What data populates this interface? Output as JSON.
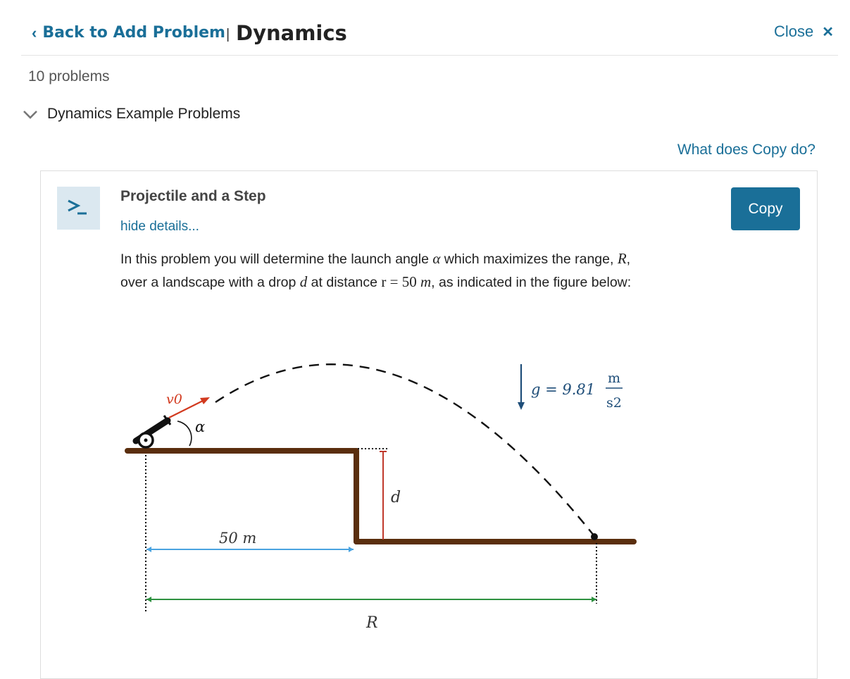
{
  "header": {
    "back_label": "Back to Add Problem",
    "separator": "|",
    "title": "Dynamics",
    "close_label": "Close",
    "close_glyph": "✕",
    "back_glyph": "‹"
  },
  "problem_count": "10 problems",
  "group": {
    "label": "Dynamics Example Problems",
    "icon": "chevron-down-icon"
  },
  "help_link": "What does Copy do?",
  "problem": {
    "icon_text": ">_",
    "title": "Projectile and a Step",
    "toggle_label": "hide details...",
    "copy_label": "Copy",
    "description": {
      "t1": "In this problem you will determine the launch angle ",
      "alpha": "α",
      "t2": " which maximizes the range, ",
      "R": "R",
      "t3": ",",
      "t4": "over a landscape with a drop ",
      "d": "d",
      "t5": " at distance ",
      "r_eq": "r = 50 ",
      "m_unit": "m",
      "t6": ", as indicated in the figure below:"
    },
    "figure": {
      "v0_label": "v0",
      "alpha_label": "α",
      "d_label": "d",
      "distance_label": "50 m",
      "range_label": "R",
      "g_label": "g = 9.81",
      "g_unit_num": "m",
      "g_unit_den": "s2"
    }
  },
  "colors": {
    "link": "#1a6f98",
    "button": "#1a6f98",
    "ground": "#5a2e0e",
    "velocity": "#d23a1f",
    "drop": "#c0392b",
    "distance_line": "#4aa3e0",
    "range_line": "#2e9140",
    "gravity": "#1f4e79"
  }
}
